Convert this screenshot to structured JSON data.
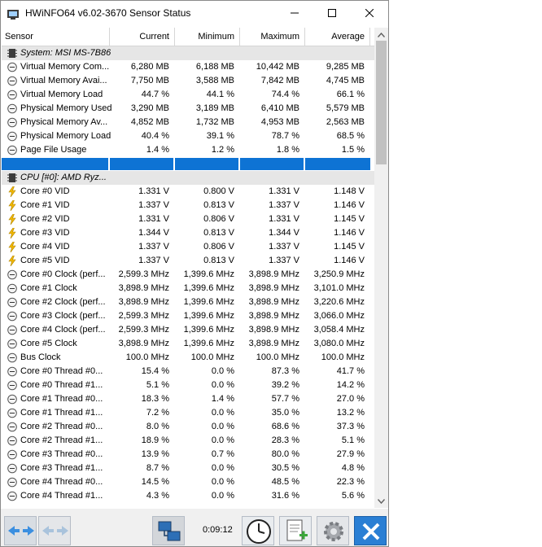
{
  "window": {
    "title": "HWiNFO64 v6.02-3670 Sensor Status"
  },
  "columns": [
    "Sensor",
    "Current",
    "Minimum",
    "Maximum",
    "Average"
  ],
  "rows": [
    {
      "type": "group",
      "name": "System: MSI MS-7B86"
    },
    {
      "type": "mem",
      "name": "Virtual Memory Com...",
      "cur": "6,280 MB",
      "min": "6,188 MB",
      "max": "10,442 MB",
      "avg": "9,285 MB"
    },
    {
      "type": "mem",
      "name": "Virtual Memory Avai...",
      "cur": "7,750 MB",
      "min": "3,588 MB",
      "max": "7,842 MB",
      "avg": "4,745 MB"
    },
    {
      "type": "mem",
      "name": "Virtual Memory Load",
      "cur": "44.7 %",
      "min": "44.1 %",
      "max": "74.4 %",
      "avg": "66.1 %"
    },
    {
      "type": "mem",
      "name": "Physical Memory Used",
      "cur": "3,290 MB",
      "min": "3,189 MB",
      "max": "6,410 MB",
      "avg": "5,579 MB"
    },
    {
      "type": "mem",
      "name": "Physical Memory Av...",
      "cur": "4,852 MB",
      "min": "1,732 MB",
      "max": "4,953 MB",
      "avg": "2,563 MB"
    },
    {
      "type": "mem",
      "name": "Physical Memory Load",
      "cur": "40.4 %",
      "min": "39.1 %",
      "max": "78.7 %",
      "avg": "68.5 %"
    },
    {
      "type": "mem",
      "name": "Page File Usage",
      "cur": "1.4 %",
      "min": "1.2 %",
      "max": "1.8 %",
      "avg": "1.5 %"
    },
    {
      "type": "sel",
      "name": "",
      "cur": "",
      "min": "",
      "max": "",
      "avg": ""
    },
    {
      "type": "group",
      "name": "CPU [#0]: AMD Ryz..."
    },
    {
      "type": "volt",
      "name": "Core #0 VID",
      "cur": "1.331 V",
      "min": "0.800 V",
      "max": "1.331 V",
      "avg": "1.148 V"
    },
    {
      "type": "volt",
      "name": "Core #1 VID",
      "cur": "1.337 V",
      "min": "0.813 V",
      "max": "1.337 V",
      "avg": "1.146 V"
    },
    {
      "type": "volt",
      "name": "Core #2 VID",
      "cur": "1.331 V",
      "min": "0.806 V",
      "max": "1.331 V",
      "avg": "1.145 V"
    },
    {
      "type": "volt",
      "name": "Core #3 VID",
      "cur": "1.344 V",
      "min": "0.813 V",
      "max": "1.344 V",
      "avg": "1.146 V"
    },
    {
      "type": "volt",
      "name": "Core #4 VID",
      "cur": "1.337 V",
      "min": "0.806 V",
      "max": "1.337 V",
      "avg": "1.145 V"
    },
    {
      "type": "volt",
      "name": "Core #5 VID",
      "cur": "1.337 V",
      "min": "0.813 V",
      "max": "1.337 V",
      "avg": "1.146 V"
    },
    {
      "type": "clock",
      "name": "Core #0 Clock (perf...",
      "cur": "2,599.3 MHz",
      "min": "1,399.6 MHz",
      "max": "3,898.9 MHz",
      "avg": "3,250.9 MHz"
    },
    {
      "type": "clock",
      "name": "Core #1 Clock",
      "cur": "3,898.9 MHz",
      "min": "1,399.6 MHz",
      "max": "3,898.9 MHz",
      "avg": "3,101.0 MHz"
    },
    {
      "type": "clock",
      "name": "Core #2 Clock (perf...",
      "cur": "3,898.9 MHz",
      "min": "1,399.6 MHz",
      "max": "3,898.9 MHz",
      "avg": "3,220.6 MHz"
    },
    {
      "type": "clock",
      "name": "Core #3 Clock (perf...",
      "cur": "2,599.3 MHz",
      "min": "1,399.6 MHz",
      "max": "3,898.9 MHz",
      "avg": "3,066.0 MHz"
    },
    {
      "type": "clock",
      "name": "Core #4 Clock (perf...",
      "cur": "2,599.3 MHz",
      "min": "1,399.6 MHz",
      "max": "3,898.9 MHz",
      "avg": "3,058.4 MHz"
    },
    {
      "type": "clock",
      "name": "Core #5 Clock",
      "cur": "3,898.9 MHz",
      "min": "1,399.6 MHz",
      "max": "3,898.9 MHz",
      "avg": "3,080.0 MHz"
    },
    {
      "type": "clock",
      "name": "Bus Clock",
      "cur": "100.0 MHz",
      "min": "100.0 MHz",
      "max": "100.0 MHz",
      "avg": "100.0 MHz"
    },
    {
      "type": "clock",
      "name": "Core #0 Thread #0...",
      "cur": "15.4 %",
      "min": "0.0 %",
      "max": "87.3 %",
      "avg": "41.7 %"
    },
    {
      "type": "clock",
      "name": "Core #0 Thread #1...",
      "cur": "5.1 %",
      "min": "0.0 %",
      "max": "39.2 %",
      "avg": "14.2 %"
    },
    {
      "type": "clock",
      "name": "Core #1 Thread #0...",
      "cur": "18.3 %",
      "min": "1.4 %",
      "max": "57.7 %",
      "avg": "27.0 %"
    },
    {
      "type": "clock",
      "name": "Core #1 Thread #1...",
      "cur": "7.2 %",
      "min": "0.0 %",
      "max": "35.0 %",
      "avg": "13.2 %"
    },
    {
      "type": "clock",
      "name": "Core #2 Thread #0...",
      "cur": "8.0 %",
      "min": "0.0 %",
      "max": "68.6 %",
      "avg": "37.3 %"
    },
    {
      "type": "clock",
      "name": "Core #2 Thread #1...",
      "cur": "18.9 %",
      "min": "0.0 %",
      "max": "28.3 %",
      "avg": "5.1 %"
    },
    {
      "type": "clock",
      "name": "Core #3 Thread #0...",
      "cur": "13.9 %",
      "min": "0.7 %",
      "max": "80.0 %",
      "avg": "27.9 %"
    },
    {
      "type": "clock",
      "name": "Core #3 Thread #1...",
      "cur": "8.7 %",
      "min": "0.0 %",
      "max": "30.5 %",
      "avg": "4.8 %"
    },
    {
      "type": "clock",
      "name": "Core #4 Thread #0...",
      "cur": "14.5 %",
      "min": "0.0 %",
      "max": "48.5 %",
      "avg": "22.3 %"
    },
    {
      "type": "clock",
      "name": "Core #4 Thread #1...",
      "cur": "4.3 %",
      "min": "0.0 %",
      "max": "31.6 %",
      "avg": "5.6 %"
    }
  ],
  "toolbar": {
    "elapsed": "0:09:12"
  },
  "colors": {
    "selection": "#0e73d4",
    "group_bg": "#e6e6e6",
    "close_button": "#2a7fd4"
  }
}
